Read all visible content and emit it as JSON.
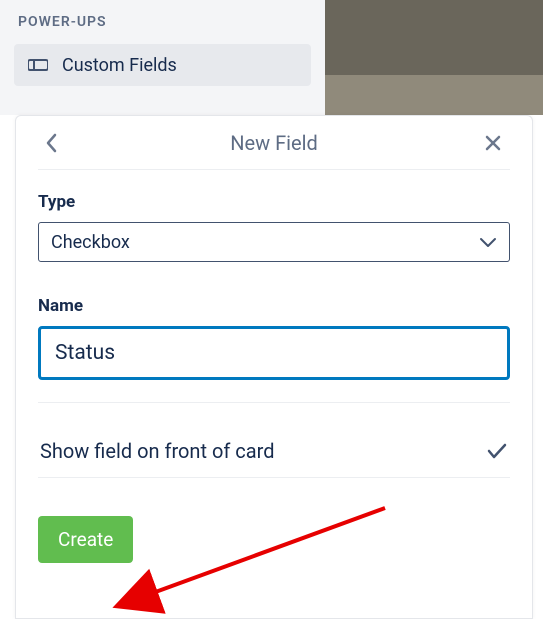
{
  "sidebar": {
    "section_title": "POWER-UPS",
    "custom_fields_label": "Custom Fields"
  },
  "panel": {
    "title": "New Field",
    "type_label": "Type",
    "type_value": "Checkbox",
    "name_label": "Name",
    "name_value": "Status",
    "show_on_front_label": "Show field on front of card",
    "create_label": "Create"
  }
}
